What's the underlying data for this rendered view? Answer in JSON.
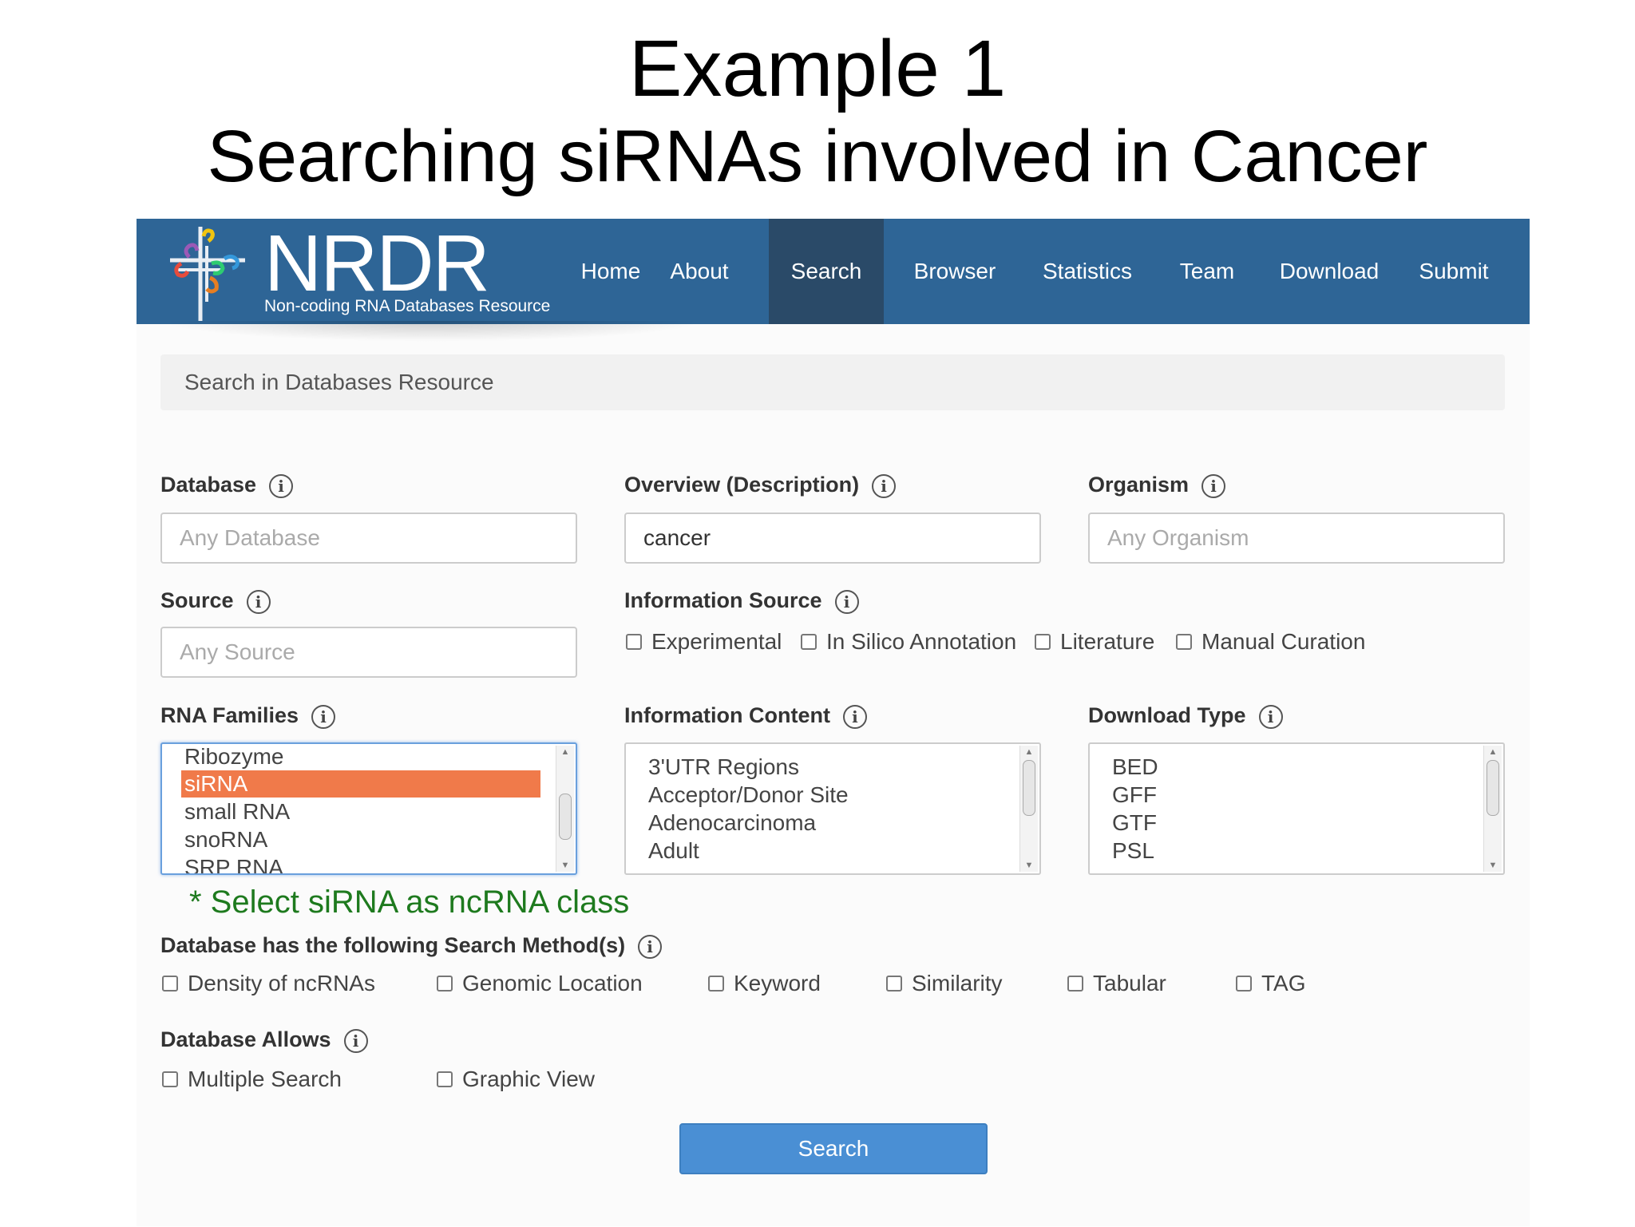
{
  "slide": {
    "title": "Example 1",
    "subtitle": "Searching siRNAs involved in Cancer"
  },
  "brand": {
    "name": "NRDR",
    "tagline": "Non-coding RNA Databases Resource"
  },
  "nav": {
    "items": [
      "Home",
      "About",
      "Search",
      "Browser",
      "Statistics",
      "Team",
      "Download",
      "Submit"
    ],
    "active": "Search"
  },
  "search_header": "Search in Databases Resource",
  "fields": {
    "database": {
      "label": "Database",
      "placeholder": "Any Database",
      "value": ""
    },
    "overview": {
      "label": "Overview (Description)",
      "placeholder": "",
      "value": "cancer"
    },
    "organism": {
      "label": "Organism",
      "placeholder": "Any Organism",
      "value": ""
    },
    "source": {
      "label": "Source",
      "placeholder": "Any Source",
      "value": ""
    }
  },
  "information_source": {
    "label": "Information Source",
    "options": [
      "Experimental",
      "In Silico Annotation",
      "Literature",
      "Manual Curation"
    ]
  },
  "rna_families": {
    "label": "RNA Families",
    "options": [
      "Ribozyme",
      "siRNA",
      "small RNA",
      "snoRNA",
      "SRP RNA"
    ],
    "selected": "siRNA"
  },
  "information_content": {
    "label": "Information Content",
    "options": [
      "3'UTR Regions",
      "Acceptor/Donor Site",
      "Adenocarcinoma",
      "Adult"
    ]
  },
  "download_type": {
    "label": "Download Type",
    "options": [
      "BED",
      "GFF",
      "GTF",
      "PSL"
    ]
  },
  "annotation": "* Select siRNA as ncRNA class",
  "search_methods": {
    "label": "Database has the following Search Method(s)",
    "options": [
      "Density of ncRNAs",
      "Genomic Location",
      "Keyword",
      "Similarity",
      "Tabular",
      "TAG"
    ]
  },
  "allows": {
    "label": "Database Allows",
    "options": [
      "Multiple Search",
      "Graphic View"
    ]
  },
  "info_glyph": "i",
  "submit_label": "Search",
  "colors": {
    "navbar": "#2e6596",
    "nav_active": "#2a4a68",
    "selected_option": "#f07a4a",
    "annotation": "#1e7a1e",
    "button": "#4a8fd4"
  }
}
